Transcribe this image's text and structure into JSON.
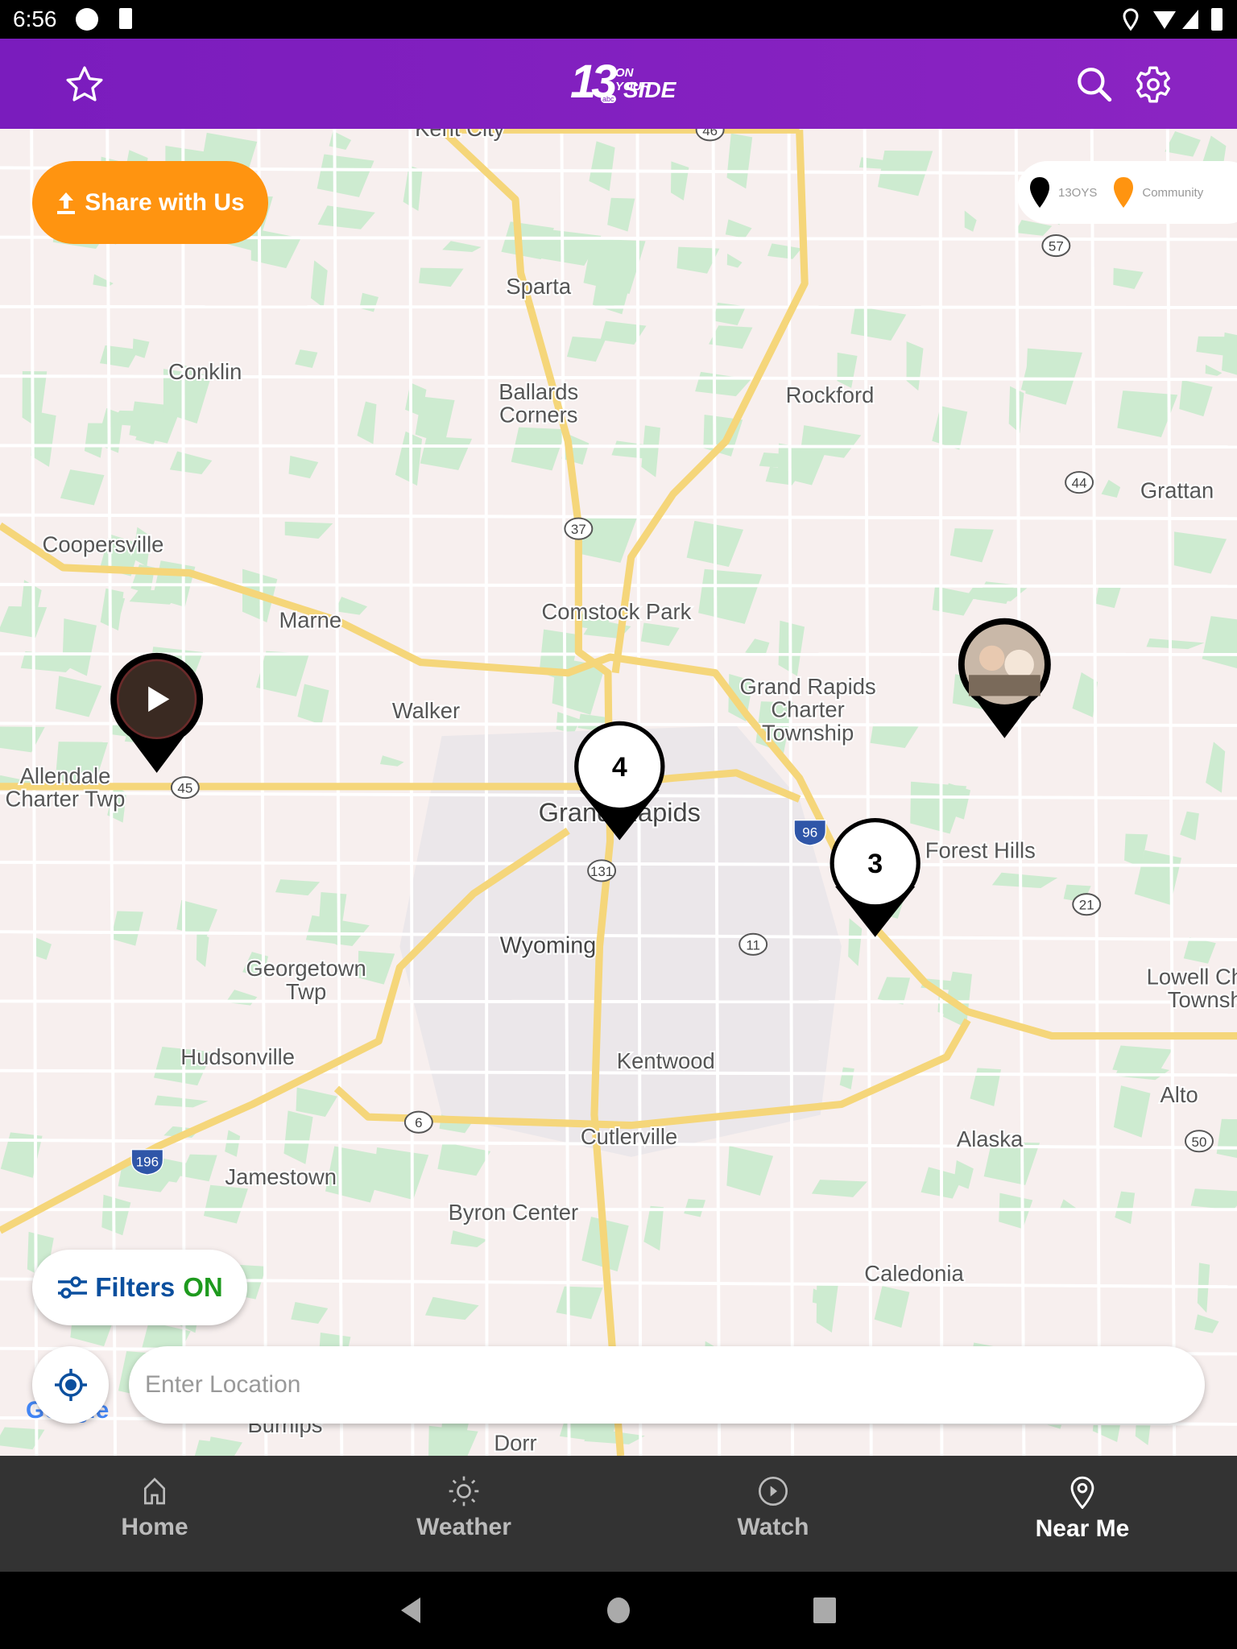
{
  "status_bar": {
    "time": "6:56"
  },
  "header": {
    "logo": {
      "number": "13",
      "line1": "ON YOUR",
      "line2": "SIDE",
      "network": "abc"
    },
    "favorite_icon": "star-icon",
    "search_icon": "search-icon",
    "settings_icon": "gear-icon",
    "background_color": "#7a1cbd"
  },
  "share_button": {
    "label": "Share with Us",
    "color": "#ff9410",
    "icon": "upload-icon"
  },
  "legend": {
    "items": [
      {
        "label": "13OYS",
        "color": "#000000"
      },
      {
        "label": "Community",
        "color": "#ff9410"
      }
    ]
  },
  "map": {
    "labels": [
      "Kent City",
      "Sparta",
      "Conklin",
      "Ballards",
      "Corners",
      "Rockford",
      "Grattan",
      "Coopersville",
      "Comstock Park",
      "Marne",
      "Walker",
      "Grand Rapids",
      "Charter",
      "Township",
      "Allendale",
      "Charter Twp",
      "Grand Rapids",
      "Forest Hills",
      "Wyoming",
      "Georgetown",
      "Twp",
      "Lowell Charter",
      "Township",
      "Hudsonville",
      "Kentwood",
      "Alto",
      "Cutlerville",
      "Alaska",
      "Jamestown",
      "Byron Center",
      "Caledonia",
      "Burnips",
      "Dorr"
    ],
    "shields": [
      "46",
      "57",
      "44",
      "37",
      "45",
      "131",
      "96",
      "11",
      "21",
      "6",
      "196",
      "50"
    ],
    "clusters": [
      {
        "count": "4"
      },
      {
        "count": "3"
      }
    ],
    "attribution": "Google"
  },
  "filters_button": {
    "label": "Filters",
    "state": "ON"
  },
  "location_input": {
    "placeholder": "Enter Location",
    "value": ""
  },
  "bottom_nav": {
    "items": [
      {
        "label": "Home",
        "icon": "home-icon"
      },
      {
        "label": "Weather",
        "icon": "sun-icon"
      },
      {
        "label": "Watch",
        "icon": "play-circle-icon"
      },
      {
        "label": "Near Me",
        "icon": "location-pin-icon",
        "active": true
      }
    ]
  }
}
